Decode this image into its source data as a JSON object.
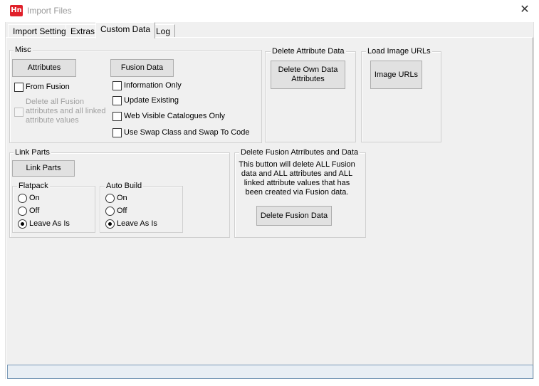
{
  "window": {
    "title": "Import Files",
    "app_icon_text": "Hn",
    "close_glyph": "✕"
  },
  "tabs": [
    {
      "label": "Import Settings",
      "active": false
    },
    {
      "label": "Extras",
      "active": false
    },
    {
      "label": "Custom Data",
      "active": true
    },
    {
      "label": "Log",
      "active": false
    }
  ],
  "misc": {
    "legend": "Misc",
    "attributes_button": "Attributes",
    "fusion_data_button": "Fusion Data",
    "from_fusion": {
      "label": "From Fusion",
      "checked": false
    },
    "delete_all": {
      "label": "Delete all Fusion attributes and all linked attribute values",
      "checked": false,
      "enabled": false
    },
    "information_only": {
      "label": "Information Only",
      "checked": false
    },
    "update_existing": {
      "label": "Update Existing",
      "checked": false
    },
    "web_visible": {
      "label": "Web Visible Catalogues Only",
      "checked": false
    },
    "swap_class": {
      "label": "Use Swap Class and Swap To Code",
      "checked": false
    }
  },
  "delete_attribute": {
    "legend": "Delete Attribute Data",
    "button": "Delete Own Data Attributes"
  },
  "load_image": {
    "legend": "Load Image URLs",
    "button": "Image URLs"
  },
  "link_parts": {
    "legend": "Link Parts",
    "button": "Link Parts",
    "flatpack": {
      "legend": "Flatpack",
      "options": [
        "On",
        "Off",
        "Leave As Is"
      ],
      "selected": "Leave As Is"
    },
    "auto_build": {
      "legend": "Auto Build",
      "options": [
        "On",
        "Off",
        "Leave As Is"
      ],
      "selected": "Leave As Is"
    }
  },
  "delete_fusion": {
    "legend": "Delete Fusion Atrributes and Data",
    "description": "This button will delete ALL Fusion data and ALL attributes and ALL linked attribute values that has been created via Fusion data.",
    "button": "Delete Fusion Data"
  },
  "status_bar": {
    "text": ""
  }
}
